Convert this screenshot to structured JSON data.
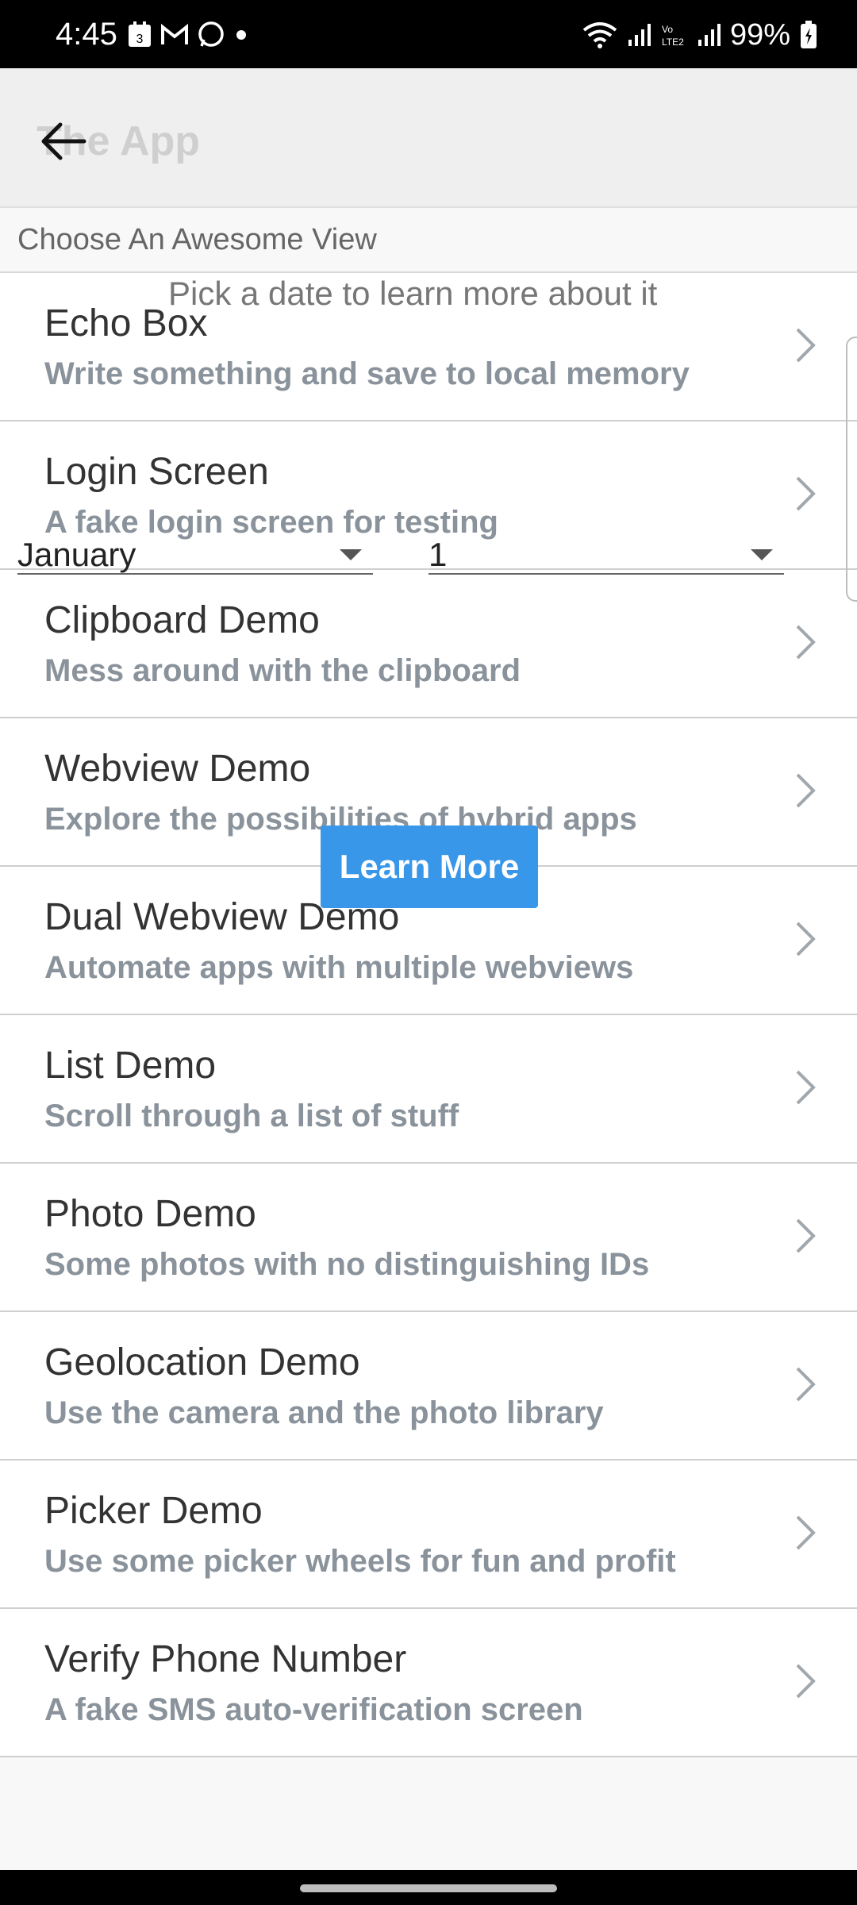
{
  "status_bar": {
    "time": "4:45",
    "battery": "99%",
    "notification_icons": [
      "calendar-icon",
      "gmail-icon",
      "whatsapp-icon",
      "dot-icon"
    ],
    "system_icons": [
      "wifi-icon",
      "signal-icon",
      "volte-icon",
      "signal-icon",
      "battery-icon"
    ]
  },
  "app_bar": {
    "title": "The App",
    "back_icon": "back-arrow-icon"
  },
  "section_header": "Choose An Awesome View",
  "list_items": [
    {
      "title": "Echo Box",
      "subtitle": "Write something and save to local memory"
    },
    {
      "title": "Login Screen",
      "subtitle": "A fake login screen for testing"
    },
    {
      "title": "Clipboard Demo",
      "subtitle": "Mess around with the clipboard"
    },
    {
      "title": "Webview Demo",
      "subtitle": "Explore the possibilities of hybrid apps"
    },
    {
      "title": "Dual Webview Demo",
      "subtitle": "Automate apps with multiple webviews"
    },
    {
      "title": "List Demo",
      "subtitle": "Scroll through a list of stuff"
    },
    {
      "title": "Photo Demo",
      "subtitle": "Some photos with no distinguishing IDs"
    },
    {
      "title": "Geolocation Demo",
      "subtitle": "Use the camera and the photo library"
    },
    {
      "title": "Picker Demo",
      "subtitle": "Use some picker wheels for fun and profit"
    },
    {
      "title": "Verify Phone Number",
      "subtitle": "A fake SMS auto-verification screen"
    }
  ],
  "overlay": {
    "hint": "Pick a date to learn more about it",
    "month_value": "January",
    "day_value": "1",
    "learn_more_label": "Learn More"
  },
  "colors": {
    "button": "#3897e8",
    "subtitle": "#8a939b",
    "status_bar": "#000000"
  }
}
